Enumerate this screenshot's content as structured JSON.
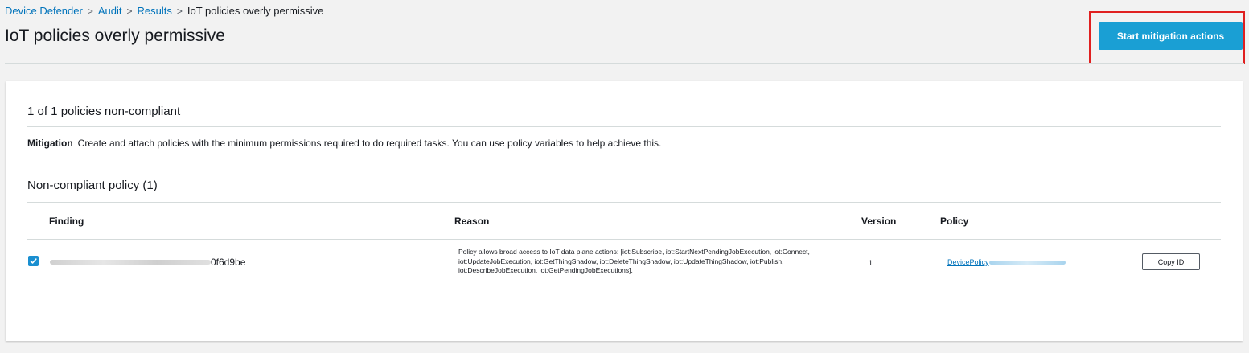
{
  "breadcrumb": {
    "items": [
      "Device Defender",
      "Audit",
      "Results"
    ],
    "current": "IoT policies overly permissive",
    "separator": ">"
  },
  "page": {
    "title": "IoT policies overly permissive",
    "primary_action": "Start mitigation actions"
  },
  "summary": {
    "title": "1 of 1 policies non-compliant",
    "mitigation_label": "Mitigation",
    "mitigation_text": "Create and attach policies with the minimum permissions required to do required tasks. You can use policy variables to help achieve this."
  },
  "table": {
    "title": "Non-compliant policy (1)",
    "columns": [
      "Finding",
      "Reason",
      "Version",
      "Policy"
    ],
    "rows": [
      {
        "checked": true,
        "finding_suffix": "0f6d9be",
        "reason": "Policy allows broad access to IoT data plane actions: [iot:Subscribe, iot:StartNextPendingJobExecution, iot:Connect, iot:UpdateJobExecution, iot:GetThingShadow, iot:DeleteThingShadow, iot:UpdateThingShadow, iot:Publish, iot:DescribeJobExecution, iot:GetPendingJobExecutions].",
        "version": "1",
        "policy_prefix": "DevicePolicy",
        "copy_label": "Copy ID"
      }
    ]
  },
  "colors": {
    "primary": "#1a9fd4",
    "link": "#0073bb",
    "highlight": "#e02020"
  }
}
